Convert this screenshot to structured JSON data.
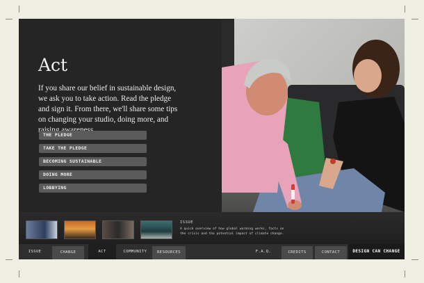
{
  "page": {
    "title": "Act",
    "intro": "If you share our belief in sustainable design, we ask you to take action. Read the pledge and sign it. From there, we'll share some tips on changing your studio, doing more, and raising awareness."
  },
  "menu": [
    {
      "label": "THE PLEDGE"
    },
    {
      "label": "TAKE THE PLEDGE"
    },
    {
      "label": "BECOMING SUSTAINABLE"
    },
    {
      "label": "DOING MORE"
    },
    {
      "label": "LOBBYING"
    }
  ],
  "thumbnails": [
    {
      "icon": "thumb-blue-figure"
    },
    {
      "icon": "thumb-orange-sunset"
    },
    {
      "icon": "thumb-dark-landscape"
    },
    {
      "icon": "thumb-teal-scene"
    }
  ],
  "issue": {
    "heading": "ISSUE",
    "description": "A quick overview of how global warming works, facts on the crisis and the potential impact of climate change."
  },
  "nav": {
    "issue": "ISSUE",
    "change": "CHANGE",
    "act": "ACT",
    "community": "COMMUNITY",
    "resources": "RESOURCES",
    "faq": "F.A.Q.",
    "credits": "CREDITS",
    "contact": "CONTACT",
    "brand": "DESIGN CAN CHANGE"
  },
  "colors": {
    "background": "#efeee2",
    "panel": "#242424",
    "menu_button": "#5b5b5b",
    "active_tab": "#1e1e1e"
  }
}
